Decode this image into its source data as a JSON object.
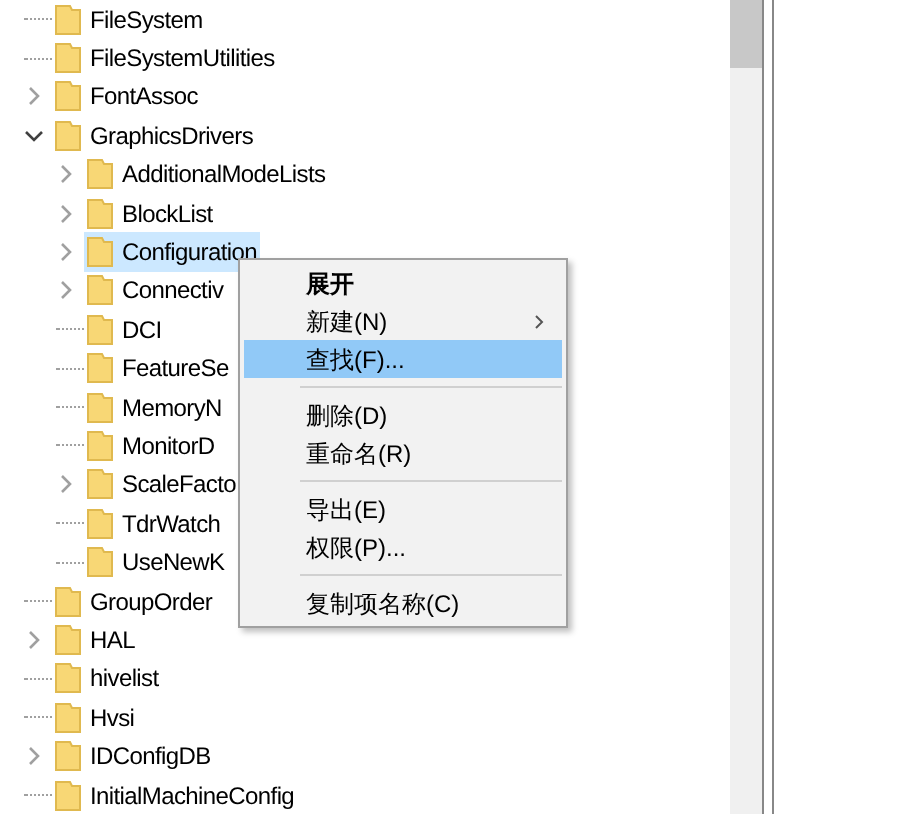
{
  "tree": [
    {
      "label": "FileSystem",
      "expandable": false,
      "selected": false
    },
    {
      "label": "FileSystemUtilities",
      "expandable": false,
      "selected": false
    },
    {
      "label": "FontAssoc",
      "expandable": true,
      "expanded": false,
      "selected": false
    },
    {
      "label": "GraphicsDrivers",
      "expandable": true,
      "expanded": true,
      "selected": false,
      "children": [
        {
          "label": "AdditionalModeLists",
          "expandable": true,
          "expanded": false,
          "selected": false
        },
        {
          "label": "BlockList",
          "expandable": true,
          "expanded": false,
          "selected": false
        },
        {
          "label": "Configuration",
          "expandable": true,
          "expanded": false,
          "selected": true
        },
        {
          "label": "Connectiv",
          "expandable": true,
          "expanded": false,
          "selected": false
        },
        {
          "label": "DCI",
          "expandable": false,
          "selected": false
        },
        {
          "label": "FeatureSe",
          "expandable": false,
          "selected": false
        },
        {
          "label": "MemoryN",
          "expandable": false,
          "selected": false
        },
        {
          "label": "MonitorD",
          "expandable": false,
          "selected": false
        },
        {
          "label": "ScaleFacto",
          "expandable": true,
          "expanded": false,
          "selected": false
        },
        {
          "label": "TdrWatch",
          "expandable": false,
          "selected": false
        },
        {
          "label": "UseNewK",
          "expandable": false,
          "selected": false
        }
      ]
    },
    {
      "label": "GroupOrder",
      "expandable": false,
      "selected": false
    },
    {
      "label": "HAL",
      "expandable": true,
      "expanded": false,
      "selected": false
    },
    {
      "label": "hivelist",
      "expandable": false,
      "selected": false
    },
    {
      "label": "Hvsi",
      "expandable": false,
      "selected": false
    },
    {
      "label": "IDConfigDB",
      "expandable": true,
      "expanded": false,
      "selected": false
    },
    {
      "label": "InitialMachineConfig",
      "expandable": false,
      "selected": false
    }
  ],
  "context_menu": [
    {
      "kind": "item",
      "label": "展开",
      "default": true,
      "submenu": false,
      "selected": false
    },
    {
      "kind": "item",
      "label": "新建(N)",
      "default": false,
      "submenu": true,
      "selected": false
    },
    {
      "kind": "item",
      "label": "查找(F)...",
      "default": false,
      "submenu": false,
      "selected": true
    },
    {
      "kind": "separator"
    },
    {
      "kind": "item",
      "label": "删除(D)",
      "default": false,
      "submenu": false,
      "selected": false
    },
    {
      "kind": "item",
      "label": "重命名(R)",
      "default": false,
      "submenu": false,
      "selected": false
    },
    {
      "kind": "separator"
    },
    {
      "kind": "item",
      "label": "导出(E)",
      "default": false,
      "submenu": false,
      "selected": false
    },
    {
      "kind": "item",
      "label": "权限(P)...",
      "default": false,
      "submenu": false,
      "selected": false
    },
    {
      "kind": "separator"
    },
    {
      "kind": "item",
      "label": "复制项名称(C)",
      "default": false,
      "submenu": false,
      "selected": false
    }
  ]
}
